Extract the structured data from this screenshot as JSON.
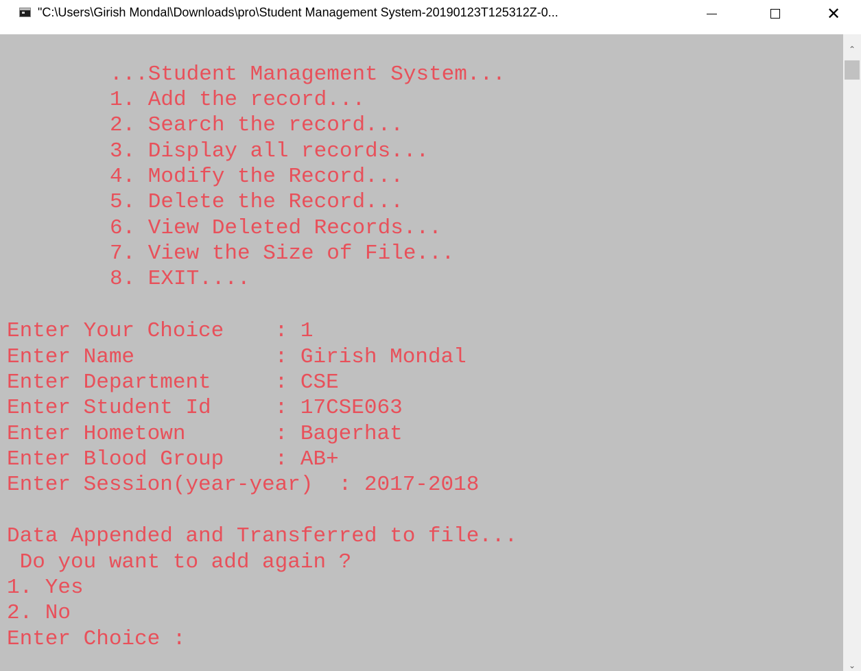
{
  "window": {
    "title": "\"C:\\Users\\Girish Mondal\\Downloads\\pro\\Student Management System-20190123T125312Z-0...",
    "controls": {
      "minimize_icon": "minimize-icon",
      "maximize_icon": "maximize-icon",
      "close_icon": "close-icon",
      "close_glyph": "✕"
    }
  },
  "console": {
    "text_color": "#e8505a",
    "background": "#c0c0c0",
    "menu": [
      "...Student Management System...",
      "1. Add the record...",
      "2. Search the record...",
      "3. Display all records...",
      "4. Modify the Record...",
      "5. Delete the Record...",
      "6. View Deleted Records...",
      "7. View the Size of File...",
      "8. EXIT...."
    ],
    "inputs": [
      "Enter Your Choice    : 1",
      "Enter Name           : Girish Mondal",
      "Enter Department     : CSE",
      "Enter Student Id     : 17CSE063",
      "Enter Hometown       : Bagerhat",
      "Enter Blood Group    : AB+",
      "Enter Session(year-year)  : 2017-2018"
    ],
    "result": [
      "Data Appended and Transferred to file...",
      " Do you want to add again ?",
      "1. Yes",
      "2. No",
      "Enter Choice :"
    ]
  },
  "scrollbar": {
    "up_arrow": "⌃",
    "down_arrow": "⌄"
  }
}
